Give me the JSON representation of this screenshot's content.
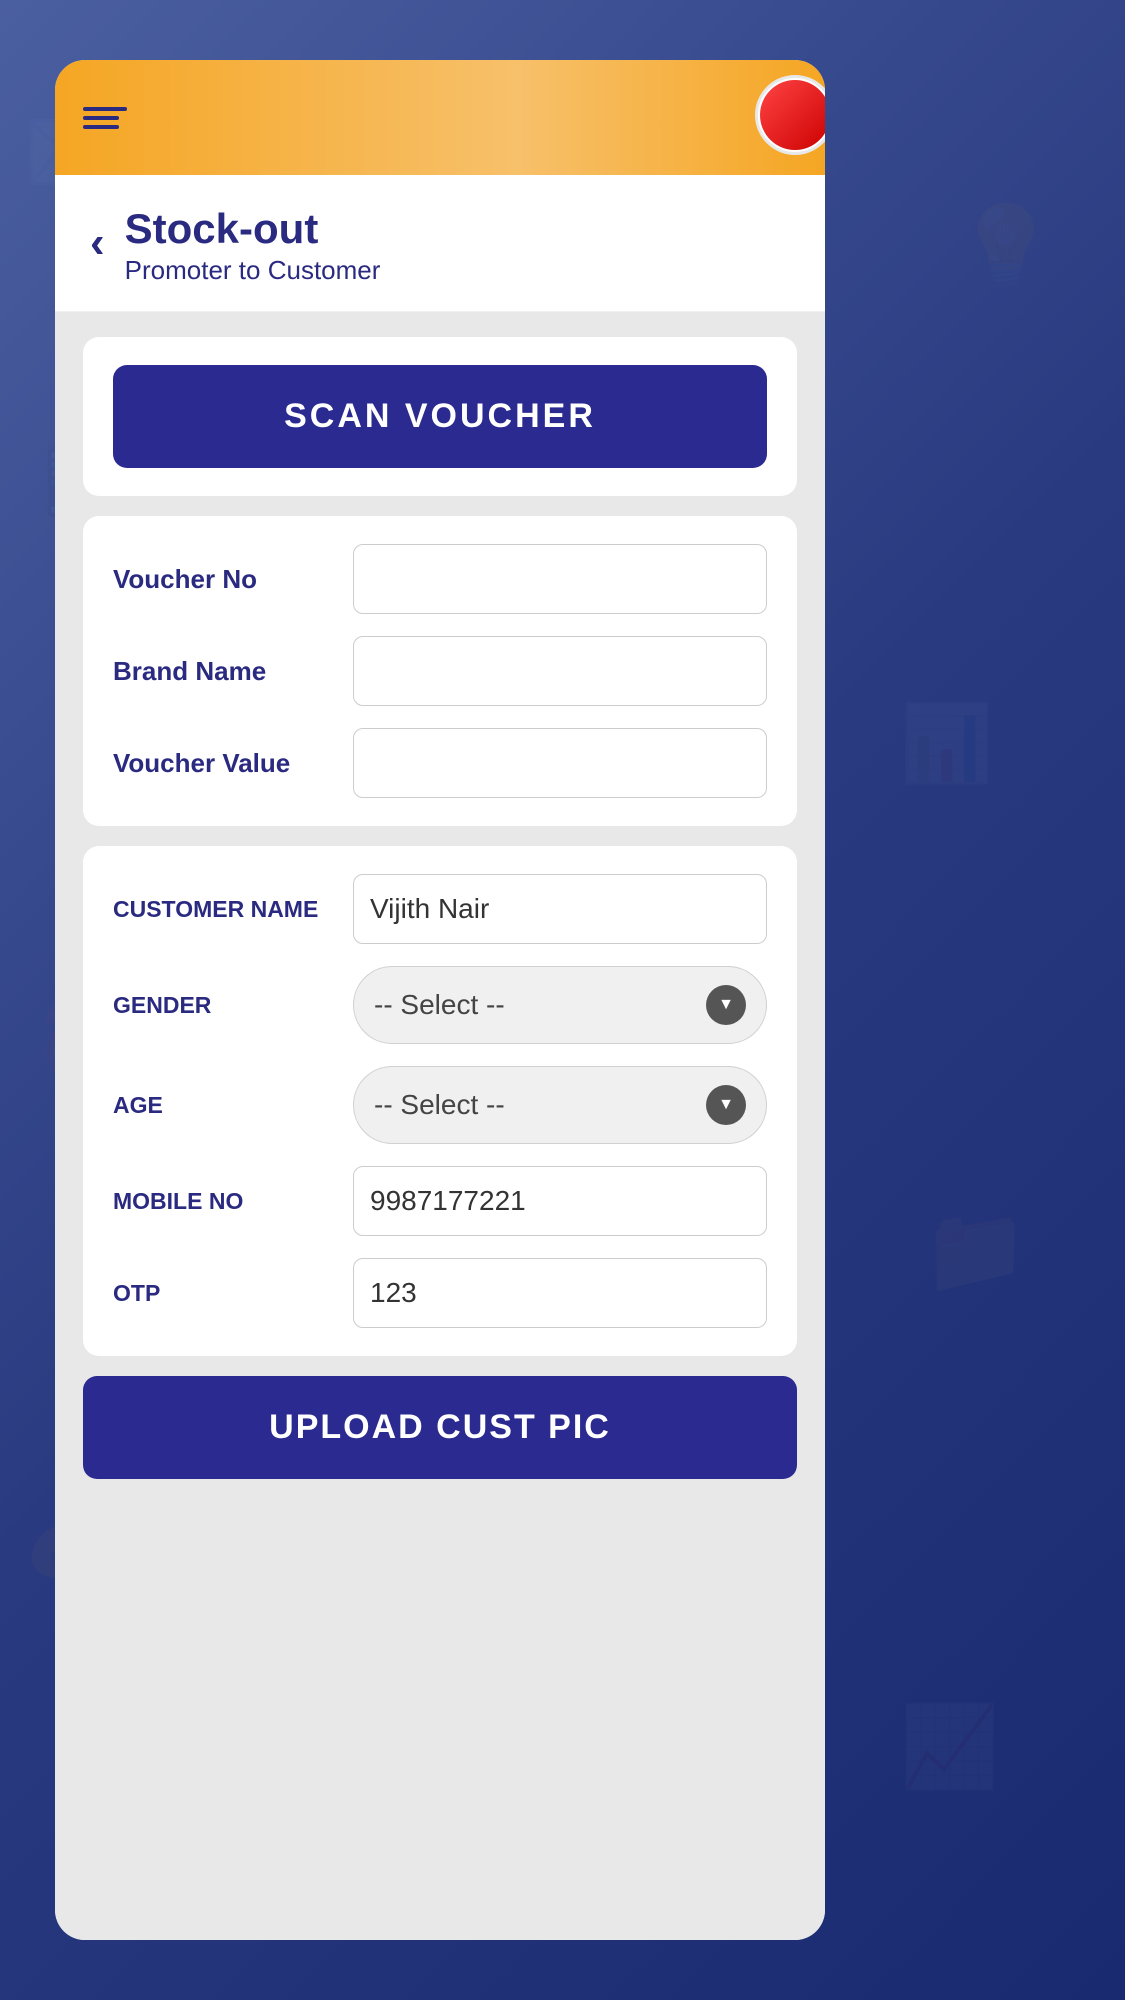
{
  "header": {
    "hamburger_label": "menu",
    "profile_label": "profile"
  },
  "page": {
    "title": "Stock-out",
    "subtitle": "Promoter to Customer",
    "back_label": "back"
  },
  "scan_voucher": {
    "label": "SCAN VOUCHER"
  },
  "voucher_form": {
    "voucher_no_label": "Voucher No",
    "voucher_no_value": "",
    "brand_name_label": "Brand Name",
    "brand_name_value": "",
    "voucher_value_label": "Voucher Value",
    "voucher_value_value": ""
  },
  "customer_form": {
    "customer_name_label": "CUSTOMER NAME",
    "customer_name_value": "Vijith Nair",
    "gender_label": "GENDER",
    "gender_placeholder": "-- Select --",
    "age_label": "AGE",
    "age_placeholder": "-- Select --",
    "mobile_no_label": "MOBILE NO",
    "mobile_no_value": "9987177221",
    "otp_label": "OTP",
    "otp_value": "123"
  },
  "upload_btn": {
    "label": "UPLOAD CUST PIC"
  },
  "colors": {
    "primary": "#2a2a90",
    "header_gradient_start": "#f5a623",
    "header_gradient_end": "#f7c06a"
  }
}
